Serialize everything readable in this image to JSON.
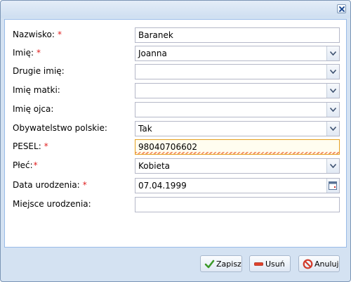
{
  "dialog": {
    "fields": [
      {
        "label": "Nazwisko:",
        "required": "*",
        "value": "Baranek",
        "type": "text"
      },
      {
        "label": "Imię:",
        "required": "*",
        "value": "Joanna",
        "type": "combo"
      },
      {
        "label": "Drugie imię:",
        "required": "",
        "value": "",
        "type": "combo"
      },
      {
        "label": "Imię matki:",
        "required": "",
        "value": "",
        "type": "combo"
      },
      {
        "label": "Imię ojca:",
        "required": "",
        "value": "",
        "type": "combo"
      },
      {
        "label": "Obywatelstwo polskie:",
        "required": "",
        "value": "Tak",
        "type": "combo"
      },
      {
        "label": "PESEL:",
        "required": "*",
        "value": "98040706602",
        "type": "text",
        "invalid": true
      },
      {
        "label": "Płeć:",
        "required": "*",
        "value": "Kobieta",
        "type": "combo"
      },
      {
        "label": "Data urodzenia:",
        "required": "*",
        "value": "07.04.1999",
        "type": "date"
      },
      {
        "label": "Miejsce urodzenia:",
        "required": "",
        "value": "",
        "type": "text"
      }
    ]
  },
  "buttons": {
    "save_label": "Zapisz",
    "delete_label": "Usuń",
    "cancel_label": "Anuluj"
  },
  "icons": {
    "close": "close-icon",
    "save": "checkmark-icon",
    "delete": "minus-icon",
    "cancel": "no-entry-icon",
    "calendar": "calendar-icon"
  },
  "colors": {
    "window_bg": "#d4e2f2",
    "border": "#99bbe8",
    "required": "#e02020",
    "invalid_underline": "#f06a33"
  }
}
